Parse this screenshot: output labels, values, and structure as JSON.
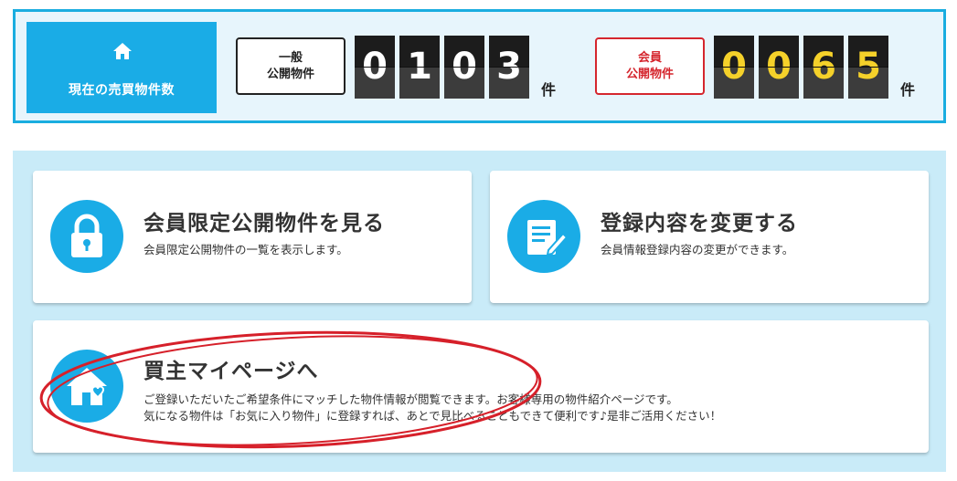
{
  "counter": {
    "title": "現在の売買物件数",
    "general": {
      "label_line1": "一般",
      "label_line2": "公開物件",
      "digits": [
        "0",
        "1",
        "0",
        "3"
      ],
      "unit": "件"
    },
    "member": {
      "label_line1": "会員",
      "label_line2": "公開物件",
      "digits": [
        "0",
        "0",
        "6",
        "5"
      ],
      "unit": "件"
    }
  },
  "cards": [
    {
      "title": "会員限定公開物件を見る",
      "desc": "会員限定公開物件の一覧を表示します。",
      "icon": "lock-icon"
    },
    {
      "title": "登録内容を変更する",
      "desc": "会員情報登録内容の変更ができます。",
      "icon": "edit-document-icon"
    },
    {
      "title": "買主マイページへ",
      "desc_line1": "ご登録いただいたご希望条件にマッチした物件情報が閲覧できます。お客様専用の物件紹介ページです。",
      "desc_line2": "気になる物件は「お気に入り物件」に登録すれば、あとで見比べることもできて便利です♪是非ご活用ください！",
      "icon": "home-heart-icon"
    }
  ],
  "colors": {
    "accent": "#1aace6",
    "member_red": "#d5262e",
    "digit_yellow": "#f5d12a",
    "annotation_red": "#d6202a"
  }
}
